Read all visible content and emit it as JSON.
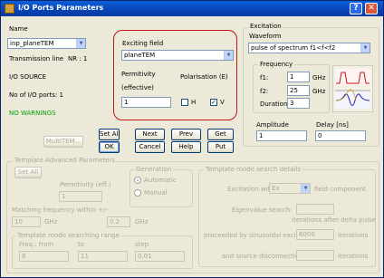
{
  "window": {
    "title": "I/O Ports Parameters",
    "help_glyph": "?",
    "close_glyph": "✕"
  },
  "left": {
    "name_label": "Name",
    "name_value": "inp_planeTEM",
    "transmission_line": "Transmission line",
    "nr": "NR : 1",
    "io_source": "I/O SOURCE",
    "num_ports": "No of I/O ports: 1",
    "warnings": "NO WARNINGS"
  },
  "exciting": {
    "field_label": "Exciting field",
    "field_value": "planeTEM",
    "permittivity_label": "Permitivity",
    "permittivity_sub": "(effective)",
    "permittivity_value": "1",
    "polarisation_label": "Polarisation (E)",
    "h_label": "H",
    "v_label": "V",
    "h_checked": false,
    "v_checked": true
  },
  "excitation": {
    "group_title": "Excitation",
    "waveform_label": "Waveform",
    "waveform_value": "pulse of spectrum f1<f<f2",
    "frequency_title": "Frequency",
    "f1_label": "f1:",
    "f1_value": "1",
    "f2_label": "f2:",
    "f2_value": "25",
    "unit": "GHz",
    "duration_label": "Duration",
    "duration_value": "3",
    "amplitude_label": "Amplitude",
    "amplitude_value": "1",
    "delay_label": "Delay [ns]",
    "delay_value": "0"
  },
  "buttons": {
    "multitem": "MultiTEM...",
    "set_all": "Set All",
    "ok": "OK",
    "next": "Next",
    "cancel": "Cancel",
    "prev": "Prev",
    "help": "Help",
    "get": "Get",
    "put": "Put"
  },
  "template_adv": {
    "title": "Template Advanced Parameters",
    "set_all": "Set All",
    "permittivity_label": "Permitivity (eff.)",
    "permittivity_value": "1",
    "matching_label": "Matching frequency  within +/-",
    "matching_value": "10",
    "matching_unit": "GHz",
    "tolerance_value": "0.2",
    "tolerance_unit": "GHz",
    "generation_title": "Generation",
    "automatic": "Automatic",
    "manual": "Manual",
    "range_title": "Template mode searching range",
    "freq_from": "Freq.: from",
    "to": "to",
    "step": "step",
    "from_value": "8",
    "to_value": "11",
    "step_value": "0.01"
  },
  "search_details": {
    "title": "Template mode search details",
    "excitation_with": "Excitation with",
    "component_value": "Ex",
    "field_component": "field component",
    "eigenvalue": "Eigenvalue search:",
    "eigen_value": "",
    "iterations_after": "iterations after delta pulse",
    "proceeded": "proceeded by sinusoidal excitation for",
    "proceeded_value": "6000",
    "iterations": "iterations",
    "disconnection": "and source disconnection for",
    "disconnection_value": "",
    "iterations2": "iterations"
  }
}
